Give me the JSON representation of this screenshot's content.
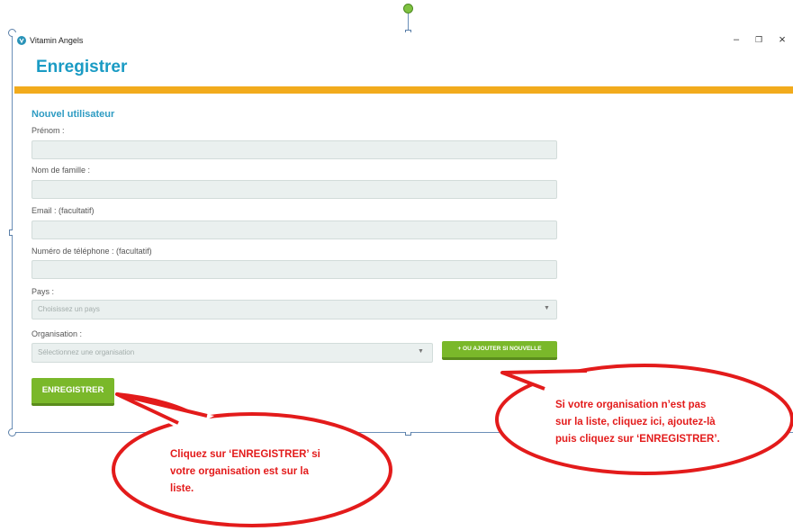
{
  "window": {
    "app_title": "Vitamin Angels",
    "controls": {
      "minimize": "–",
      "maximize": "❐",
      "close": "×"
    }
  },
  "page": {
    "heading": "Enregistrer"
  },
  "form": {
    "section_title": "Nouvel utilisateur",
    "first_name_label": "Prénom :",
    "first_name_value": "",
    "last_name_label": "Nom de famille :",
    "last_name_value": "",
    "email_label": "Email : (facultatif)",
    "email_value": "",
    "phone_label": "Numéro de téléphone : (facultatif)",
    "phone_value": "",
    "country_label": "Pays :",
    "country_placeholder": "Choisissez un pays",
    "organization_label": "Organisation :",
    "organization_placeholder": "Sélectionnez une organisation",
    "add_org_button": "+ OU AJOUTER SI NOUVELLE",
    "submit_button": "ENREGISTRER"
  },
  "callouts": {
    "left": [
      "Cliquez sur ‘ENREGISTRER’ si",
      "votre organisation est sur la",
      "liste."
    ],
    "right": [
      "Si votre organisation n’est pas",
      "sur la liste, cliquez ici, ajoutez-là",
      "puis cliquez sur ‘ENREGISTRER’."
    ]
  },
  "colors": {
    "heading": "#1a9bc4",
    "accent_bar": "#f2ab1c",
    "button_green": "#7ab82a",
    "callout_red": "#e31b1b"
  }
}
